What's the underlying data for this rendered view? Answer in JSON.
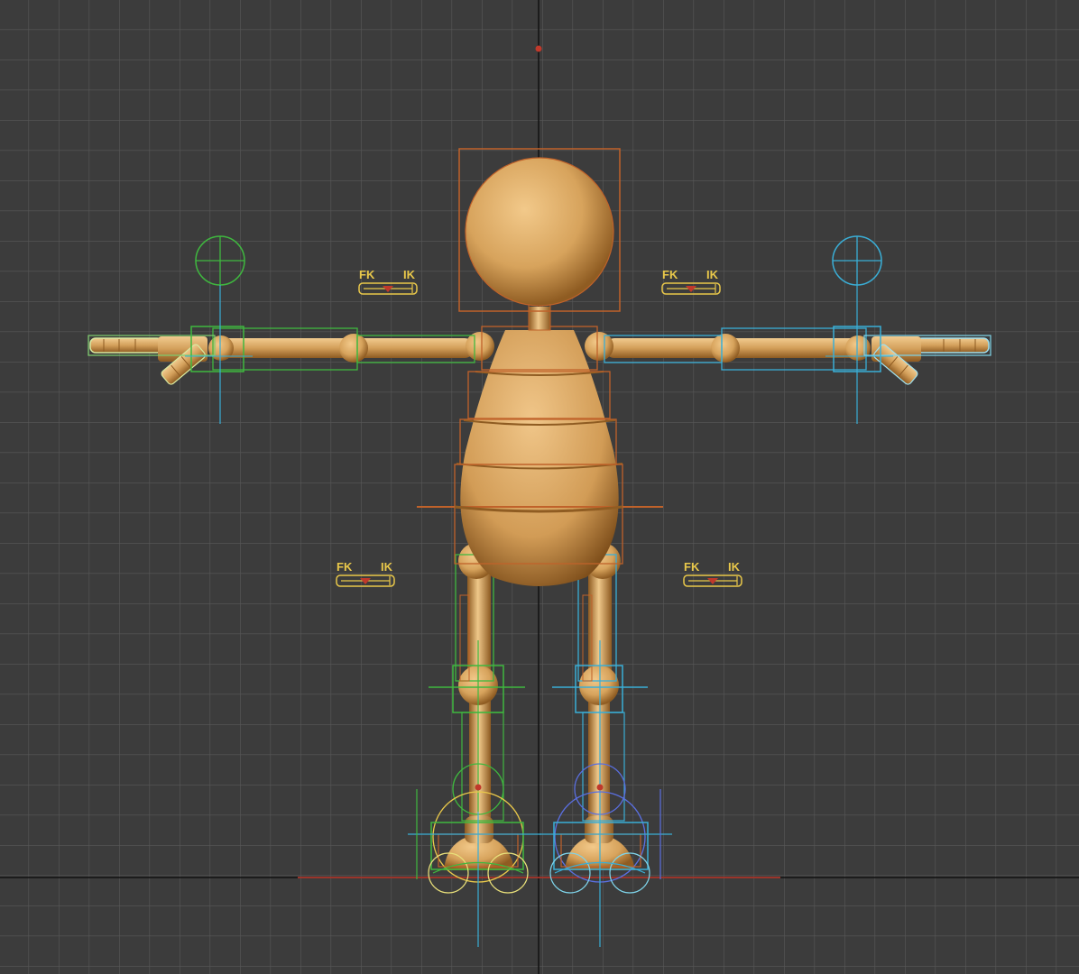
{
  "viewport": {
    "view": "front",
    "grid": "on",
    "colors": {
      "background": "#3c3c3c",
      "grid": "#5a5a5a",
      "axis_dark": "#111111",
      "axis_red": "#c0392b",
      "body": "#d7a35c",
      "body_shade": "#a26c2c",
      "bone_brown": "#c0622a",
      "rig_green": "#3fb83f",
      "rig_cyan": "#3aaed6",
      "rig_yellow": "#e9c84a",
      "rig_blue": "#5a6fe0"
    }
  },
  "fk_ik_switches": [
    {
      "name": "left-arm",
      "fk_label": "FK",
      "ik_label": "IK"
    },
    {
      "name": "right-arm",
      "fk_label": "FK",
      "ik_label": "IK"
    },
    {
      "name": "left-leg",
      "fk_label": "FK",
      "ik_label": "IK"
    },
    {
      "name": "right-leg",
      "fk_label": "FK",
      "ik_label": "IK"
    }
  ]
}
